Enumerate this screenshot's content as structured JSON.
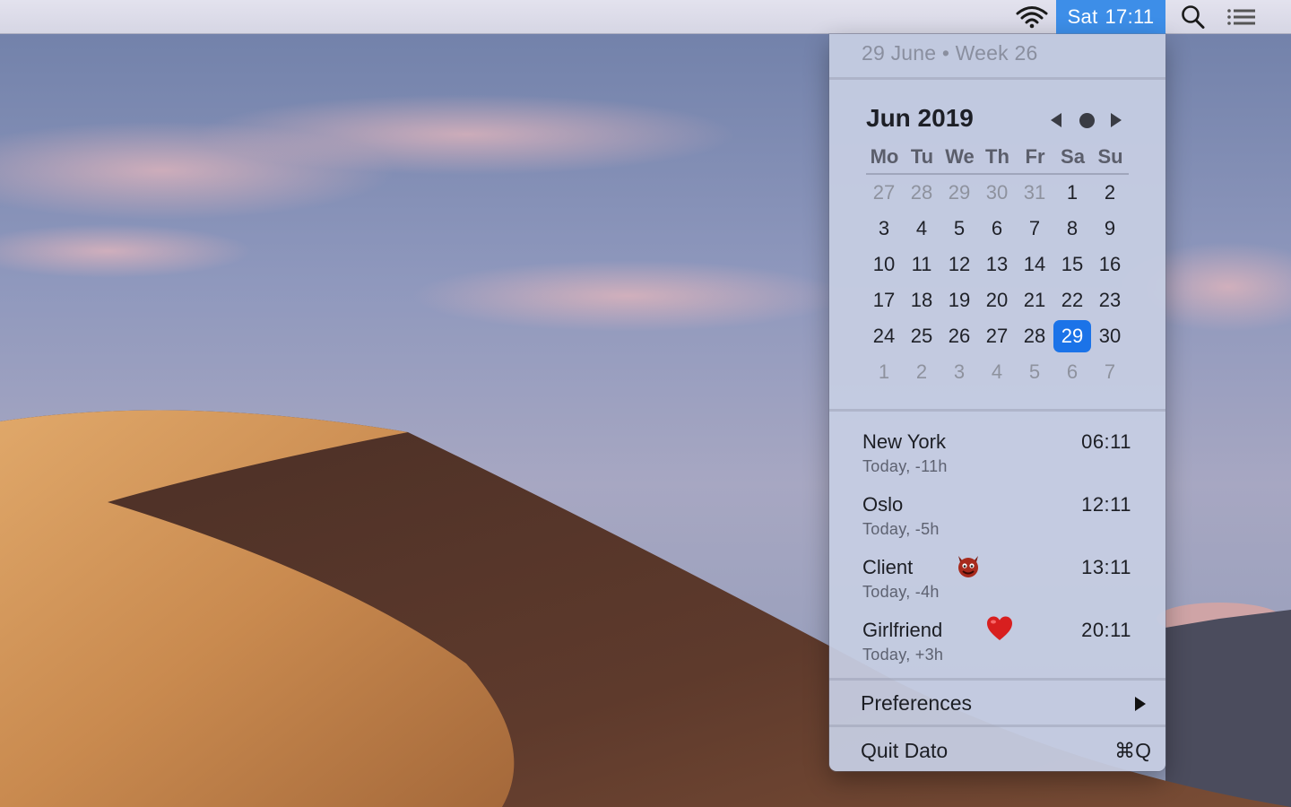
{
  "menubar": {
    "clock_day": "Sat",
    "clock_time": "17:11",
    "highlight_color": "#3d8ee8",
    "icons": [
      "wifi-icon",
      "search-icon",
      "notification-center-icon"
    ]
  },
  "panel": {
    "header_date": "29 June • Week 26",
    "calendar": {
      "title": "Jun 2019",
      "weekdays": [
        "Mo",
        "Tu",
        "We",
        "Th",
        "Fr",
        "Sa",
        "Su"
      ],
      "weeks": [
        [
          "27",
          "28",
          "29",
          "30",
          "31",
          "1",
          "2"
        ],
        [
          "3",
          "4",
          "5",
          "6",
          "7",
          "8",
          "9"
        ],
        [
          "10",
          "11",
          "12",
          "13",
          "14",
          "15",
          "16"
        ],
        [
          "17",
          "18",
          "19",
          "20",
          "21",
          "22",
          "23"
        ],
        [
          "24",
          "25",
          "26",
          "27",
          "28",
          "29",
          "30"
        ],
        [
          "1",
          "2",
          "3",
          "4",
          "5",
          "6",
          "7"
        ]
      ],
      "selected_day": "29",
      "selected_color": "#1b73e8"
    },
    "timezones": [
      {
        "name": "New York",
        "sub": "Today, -11h",
        "time": "06:11"
      },
      {
        "name": "Oslo",
        "sub": "Today, -5h",
        "time": "12:11"
      },
      {
        "name": "Client",
        "sub": "Today, -4h",
        "time": "13:11",
        "emoji": "devil-face-icon"
      },
      {
        "name": "Girlfriend",
        "sub": "Today, +3h",
        "time": "20:11",
        "emoji": "red-heart-icon"
      }
    ],
    "menu": {
      "preferences_label": "Preferences",
      "quit_label": "Quit Dato",
      "quit_shortcut": "⌘Q"
    }
  }
}
